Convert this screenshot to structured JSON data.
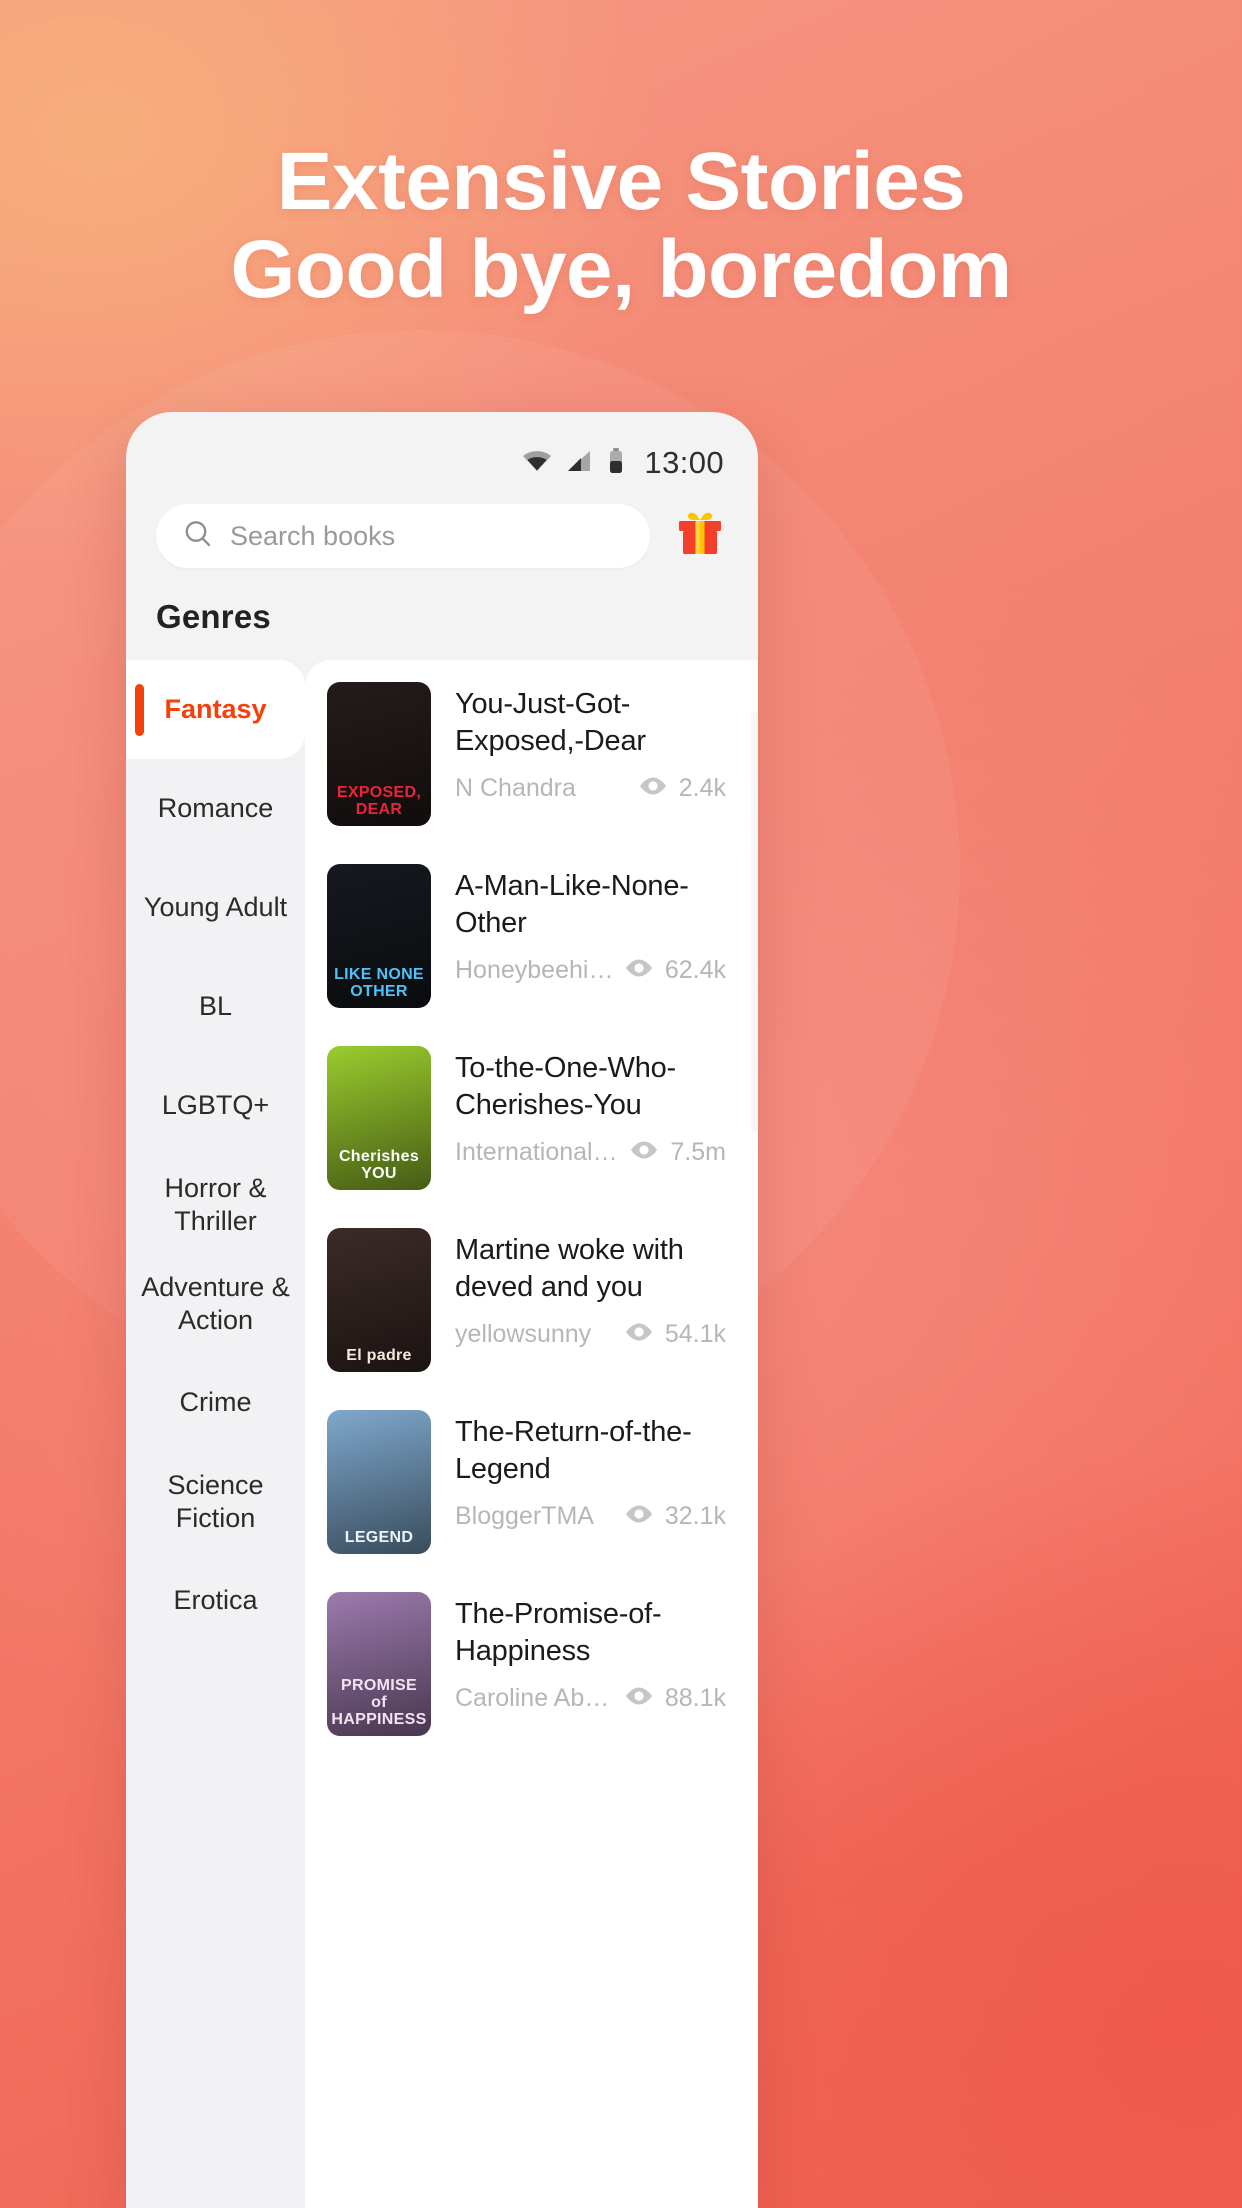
{
  "promo": {
    "headline_line1": "Extensive Stories",
    "headline_line2": "Good bye, boredom",
    "background_color": "#F58070",
    "headline_color": "#FFFFFF"
  },
  "phone": {
    "status_bar": {
      "time": "13:00",
      "wifi_icon": "wifi-icon",
      "signal_icon": "signal-bars-icon",
      "battery_icon": "battery-icon"
    },
    "search": {
      "placeholder": "Search books",
      "icon": "search-icon"
    },
    "gift": {
      "icon": "gift-icon"
    },
    "section_title": "Genres",
    "accent_color": "#F4400B",
    "genres": [
      {
        "label": "Fantasy",
        "active": true
      },
      {
        "label": "Romance",
        "active": false
      },
      {
        "label": "Young Adult",
        "active": false
      },
      {
        "label": "BL",
        "active": false
      },
      {
        "label": "LGBTQ+",
        "active": false
      },
      {
        "label": "Horror & Thriller",
        "active": false
      },
      {
        "label": "Adventure & Action",
        "active": false
      },
      {
        "label": "Crime",
        "active": false
      },
      {
        "label": "Science Fiction",
        "active": false
      },
      {
        "label": "Erotica",
        "active": false
      }
    ],
    "books": [
      {
        "title": "You-Just-Got-Exposed,-Dear",
        "author": "N Chandra",
        "views": "2.4k",
        "views_icon": "eye-icon",
        "cover_label": "EXPOSED, DEAR",
        "cover_text_color": "#E8253B",
        "cover_bg": "#241c1a"
      },
      {
        "title": "A-Man-Like-None-Other",
        "author": "Honeybeehive",
        "views": "62.4k",
        "views_icon": "eye-icon",
        "cover_label": "LIKE NONE OTHER",
        "cover_text_color": "#4FC3F7",
        "cover_bg": "#16191f"
      },
      {
        "title": "To-the-One-Who-Cherishes-You",
        "author": "International_Pen",
        "views": "7.5m",
        "views_icon": "eye-icon",
        "cover_label": "Cherishes YOU",
        "cover_text_color": "#FFFFFF",
        "cover_bg": "#9ACC2E"
      },
      {
        "title": "Martine woke with deved and you",
        "author": "yellowsunny",
        "views": "54.1k",
        "views_icon": "eye-icon",
        "cover_label": "El padre",
        "cover_text_color": "#F3E9DD",
        "cover_bg": "#3b2b28"
      },
      {
        "title": "The-Return-of-the-Legend",
        "author": "BloggerTMA",
        "views": "32.1k",
        "views_icon": "eye-icon",
        "cover_label": "LEGEND",
        "cover_text_color": "#EAF4FB",
        "cover_bg": "#7FA8CD"
      },
      {
        "title": "The-Promise-of-Happiness",
        "author": "Caroline Above Story",
        "views": "88.1k",
        "views_icon": "eye-icon",
        "cover_label": "PROMISE of HAPPINESS",
        "cover_text_color": "#F2E3F3",
        "cover_bg": "#9E7AAE"
      }
    ]
  }
}
